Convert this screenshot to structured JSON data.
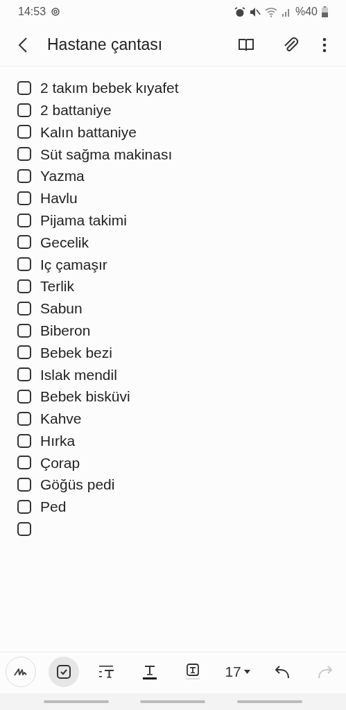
{
  "status_bar": {
    "time": "14:53",
    "battery": "%40"
  },
  "header": {
    "title": "Hastane çantası"
  },
  "checklist": [
    {
      "text": "2 takım bebek kıyafet",
      "checked": false
    },
    {
      "text": "2 battaniye",
      "checked": false
    },
    {
      "text": "Kalın battaniye",
      "checked": false
    },
    {
      "text": "Süt sağma makinası",
      "checked": false
    },
    {
      "text": "Yazma",
      "checked": false
    },
    {
      "text": "Havlu",
      "checked": false
    },
    {
      "text": "Pijama takimi",
      "checked": false
    },
    {
      "text": "Gecelik",
      "checked": false
    },
    {
      "text": "Iç çamaşır",
      "checked": false
    },
    {
      "text": "Terlik",
      "checked": false
    },
    {
      "text": "Sabun",
      "checked": false
    },
    {
      "text": "Biberon",
      "checked": false
    },
    {
      "text": "Bebek bezi",
      "checked": false
    },
    {
      "text": "Islak mendil",
      "checked": false
    },
    {
      "text": "Bebek bisküvi",
      "checked": false
    },
    {
      "text": "Kahve",
      "checked": false
    },
    {
      "text": "Hırka",
      "checked": false
    },
    {
      "text": "Çorap",
      "checked": false
    },
    {
      "text": "Göğüs pedi",
      "checked": false
    },
    {
      "text": "Ped",
      "checked": false
    },
    {
      "checked": false
    }
  ],
  "toolbar": [
    {
      "kind": "pen",
      "selected": false
    },
    {
      "kind": "checklist",
      "selected": true
    },
    {
      "kind": "paragraph",
      "selected": false
    },
    {
      "kind": "text-color",
      "selected": false
    },
    {
      "kind": "text-highlight",
      "selected": false
    },
    {
      "kind": "font-size",
      "label": "17",
      "selected": false
    },
    {
      "kind": "undo",
      "selected": false,
      "disabled": false
    },
    {
      "kind": "redo",
      "selected": false,
      "disabled": true
    }
  ]
}
